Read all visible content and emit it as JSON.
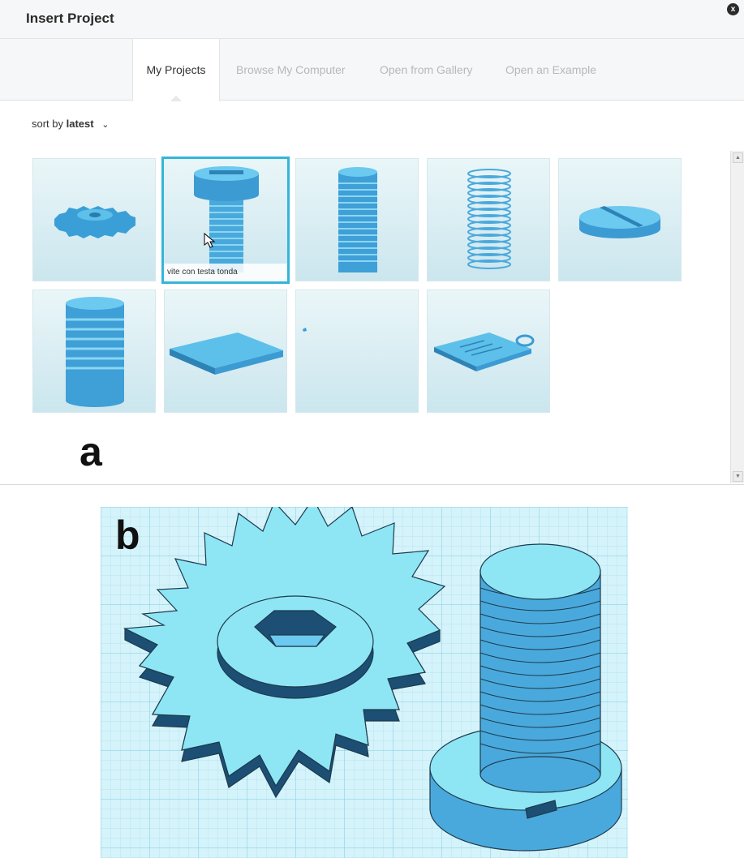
{
  "dialog": {
    "title": "Insert Project",
    "close_glyph": "x"
  },
  "tabs": [
    {
      "label": "My Projects",
      "active": true
    },
    {
      "label": "Browse My Computer",
      "active": false
    },
    {
      "label": "Open from Gallery",
      "active": false
    },
    {
      "label": "Open an Example",
      "active": false
    }
  ],
  "sort": {
    "prefix": "sort by",
    "value": "latest",
    "chevron": "chevron-down-icon"
  },
  "projects": [
    {
      "icon": "gear-icon",
      "caption": ""
    },
    {
      "icon": "screw-icon",
      "caption": "vite con testa tonda",
      "selected": true
    },
    {
      "icon": "threaded-rod-icon",
      "caption": ""
    },
    {
      "icon": "spring-icon",
      "caption": ""
    },
    {
      "icon": "slotted-head-icon",
      "caption": ""
    },
    {
      "icon": "threaded-cylinder-icon",
      "caption": ""
    },
    {
      "icon": "plate-icon",
      "caption": ""
    },
    {
      "icon": "empty-project-icon",
      "caption": ""
    },
    {
      "icon": "keychain-icon",
      "caption": ""
    }
  ],
  "labels": {
    "a": "a",
    "b": "b"
  },
  "colors": {
    "accent": "#35b5d8",
    "model": "#4aa9dc",
    "model_light": "#8ee6f5"
  }
}
